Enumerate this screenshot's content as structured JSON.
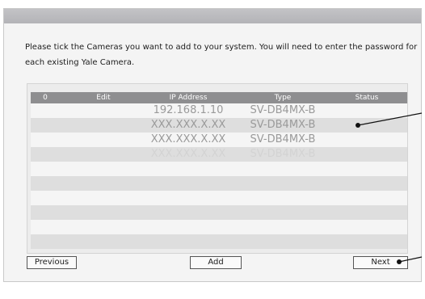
{
  "instructions": "Please tick the Cameras you want to add to your system. You will need to enter the password for each existing Yale Camera.",
  "table": {
    "headers": [
      "0",
      "Edit",
      "IP Address",
      "Type",
      "Status"
    ],
    "rows": [
      {
        "ip": "192.168.1.10",
        "type": "SV-DB4MX-B",
        "status": ""
      },
      {
        "ip": "XXX.XXX.X.XX",
        "type": "SV-DB4MX-B",
        "status": ""
      },
      {
        "ip": "XXX.XXX.X.XX",
        "type": "SV-DB4MX-B",
        "status": ""
      },
      {
        "ip": "XXX.XXX.X.XX",
        "type": "SV-DB4MX-B",
        "status": ""
      }
    ]
  },
  "buttons": {
    "previous": "Previous",
    "add": "Add",
    "next": "Next"
  },
  "colors": {
    "header_bg": "#8e8e90",
    "window_bg": "#f4f4f4"
  }
}
